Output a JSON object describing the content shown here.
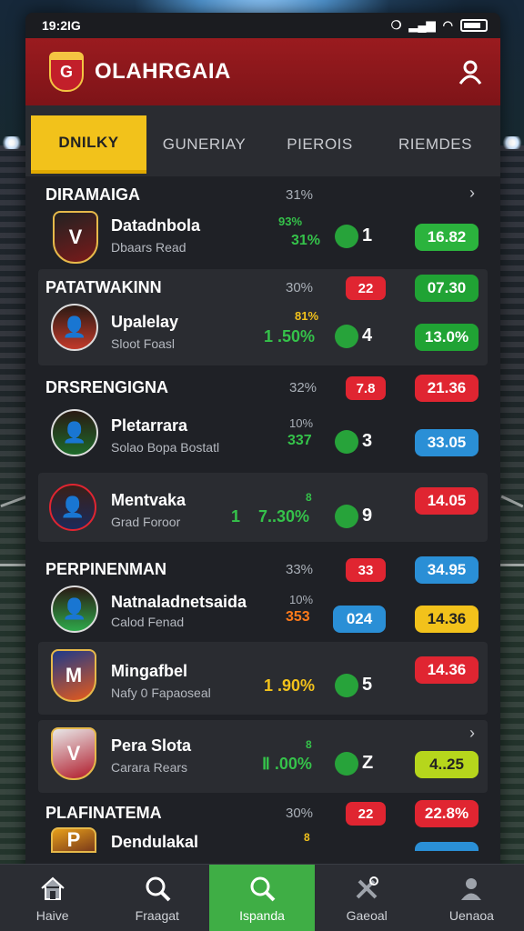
{
  "status": {
    "time": "19:2IG",
    "icons": [
      "nfc-icon",
      "signal-icon",
      "wifi-icon",
      "battery-icon"
    ]
  },
  "app": {
    "title": "OLAHRGAIA",
    "crest": "G"
  },
  "tabs": [
    {
      "label": "DNILKY",
      "active": true
    },
    {
      "label": "GUNERIAY",
      "active": false
    },
    {
      "label": "PIEROIS",
      "active": false
    },
    {
      "label": "RIEMDES",
      "active": false
    }
  ],
  "sections": [
    {
      "title": "DIRAMAIGA",
      "pct": "31%",
      "rows": [
        {
          "name": "Datadnbola",
          "sub": "Dbaars Read",
          "stat_top": "93%",
          "stat": "31%",
          "rank": "1",
          "value": "16.82",
          "crest": "V"
        }
      ]
    },
    {
      "title": "PATATWAKINN",
      "pct": "30%",
      "pill": "22",
      "value_top": "07.30",
      "rows": [
        {
          "name": "Upalelay",
          "sub": "Sloot Foasl",
          "stat_top": "81%",
          "stat": "1 .50%",
          "rank": "4",
          "value": "13.0%"
        }
      ]
    },
    {
      "title": "DRSRENGIGNA",
      "pct": "32%",
      "pill": "7.8",
      "value_top": "21.36",
      "rows": [
        {
          "name": "Pletarrara",
          "sub": "Solao Bopa Bostatl",
          "stat_top": "10%",
          "stat": "337",
          "rank": "3",
          "value": "33.05"
        }
      ]
    },
    {
      "title": "",
      "pct": "",
      "rows": [
        {
          "name": "Mentvaka",
          "sub": "Grad Foroor",
          "stat_top": "8",
          "stat": "1    7..30%",
          "rank": "9",
          "value": "14.05"
        }
      ]
    },
    {
      "title": "PERPINENMAN",
      "pct": "33%",
      "pill": "33",
      "value_top": "34.95",
      "rows": [
        {
          "name": "Natnaladnetsaida",
          "sub": "Calod Fenad",
          "stat_top": "10%",
          "stat": "353",
          "rank": "024",
          "value": "14.36"
        }
      ]
    },
    {
      "title": "",
      "pct": "",
      "rows": [
        {
          "name": "Mingafbel",
          "sub": "Nafy 0 Fapaoseal",
          "stat_top": "",
          "stat": "1 .90%",
          "rank": "5",
          "value": "14.36",
          "crest": "M"
        }
      ]
    },
    {
      "title": "",
      "pct": "",
      "rows": [
        {
          "name": "Pera Slota",
          "sub": "Carara Rears",
          "stat_top": "8",
          "stat": "Ⅱ .00%",
          "rank": "Z",
          "value": "4..25",
          "crest": "V"
        }
      ]
    },
    {
      "title": "PLAFINATEMA",
      "pct": "30%",
      "pill": "22",
      "value_top": "22.8%",
      "rows": [
        {
          "name": "Dendulakal",
          "sub": "",
          "stat_top": "8",
          "crest": "P"
        }
      ]
    }
  ],
  "nav": [
    {
      "label": "Haive",
      "icon": "home-icon",
      "active": false
    },
    {
      "label": "Fraagat",
      "icon": "search-icon",
      "active": false
    },
    {
      "label": "Ispanda",
      "icon": "search-icon",
      "active": true
    },
    {
      "label": "Gaeoal",
      "icon": "tools-icon",
      "active": false
    },
    {
      "label": "Uenaoa",
      "icon": "profile-icon",
      "active": false
    }
  ]
}
